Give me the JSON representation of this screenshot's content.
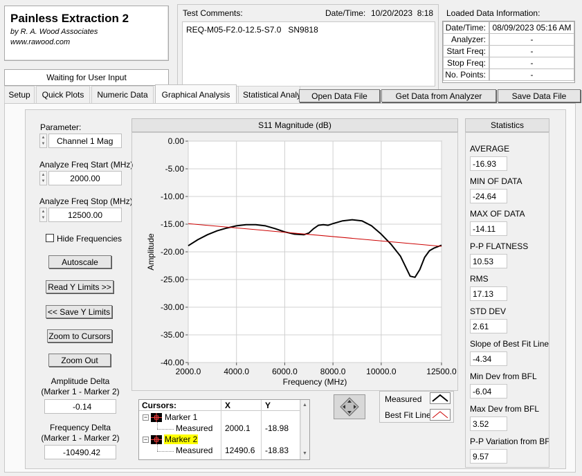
{
  "app": {
    "title": "Painless Extraction 2",
    "by": "by R. A. Wood Associates",
    "url": "www.rawood.com",
    "status": "Waiting for User Input"
  },
  "comments": {
    "label": "Test Comments:",
    "datetime_label": "Date/Time:",
    "datetime_value": "10/20/2023  8:18",
    "text": "REQ-M05-F2.0-12.5-S7.0   SN9818"
  },
  "loaded": {
    "title": "Loaded Data Information:",
    "rows": [
      {
        "label": "Date/Time:",
        "value": "08/09/2023 05:16 AM"
      },
      {
        "label": "Analyzer:",
        "value": "-"
      },
      {
        "label": "Start Freq:",
        "value": "-"
      },
      {
        "label": "Stop Freq:",
        "value": "-"
      },
      {
        "label": "No. Points:",
        "value": "-"
      }
    ]
  },
  "tabs": [
    "Setup",
    "Quick Plots",
    "Numeric Data",
    "Graphical Analysis",
    "Statistical Analy"
  ],
  "toolbar": {
    "open": "Open Data File",
    "get": "Get Data from Analyzer",
    "save": "Save Data File"
  },
  "left": {
    "parameter_label": "Parameter:",
    "parameter_value": "Channel 1 Mag",
    "start_label": "Analyze Freq Start (MHz)",
    "start_value": "2000.00",
    "stop_label": "Analyze Freq Stop (MHz)",
    "stop_value": "12500.00",
    "hide_freq": "Hide Frequencies",
    "autoscale": "Autoscale",
    "read_y": "Read Y Limits >>",
    "save_y": "<< Save Y Limits",
    "zoom_cursors": "Zoom to Cursors",
    "zoom_out": "Zoom Out",
    "amp_delta_label1": "Amplitude Delta",
    "amp_delta_label2": "(Marker 1 - Marker 2)",
    "amp_delta_value": "-0.14",
    "freq_delta_label1": "Frequency Delta",
    "freq_delta_label2": "(Marker 1 - Marker 2)",
    "freq_delta_value": "-10490.42"
  },
  "legend": {
    "measured": "Measured",
    "best_fit": "Best Fit Line"
  },
  "cursors": {
    "headers": [
      "Cursors:",
      "X",
      "Y"
    ],
    "marker1": "Marker 1",
    "marker2": "Marker 2",
    "m1_label": "Measured",
    "m1_x": "2000.1",
    "m1_y": "-18.98",
    "m2_label": "Measured",
    "m2_x": "12490.6",
    "m2_y": "-18.83"
  },
  "statistics": {
    "title": "Statistics",
    "items": [
      {
        "label": "AVERAGE",
        "value": "-16.93"
      },
      {
        "label": "MIN OF DATA",
        "value": "-24.64"
      },
      {
        "label": "MAX OF DATA",
        "value": "-14.11"
      },
      {
        "label": "P-P FLATNESS",
        "value": "10.53"
      },
      {
        "label": "RMS",
        "value": "17.13"
      },
      {
        "label": "STD DEV",
        "value": "2.61"
      },
      {
        "label": "Slope of Best Fit Line",
        "value": "-4.34"
      },
      {
        "label": "Min Dev from BFL",
        "value": "-6.04"
      },
      {
        "label": "Max Dev from BFL",
        "value": "3.52"
      },
      {
        "label": "P-P Variation from BF",
        "value": "9.57"
      }
    ]
  },
  "colors": {
    "measured": "#000000",
    "best_fit": "#cc0000",
    "highlight": "#ffff00",
    "plot_bg": "#ffffff",
    "grid": "#d0d0d0"
  },
  "chart_data": {
    "type": "line",
    "title": "S11 Magnitude (dB)",
    "xlabel": "Frequency (MHz)",
    "ylabel": "Amplitude",
    "xlim": [
      2000,
      12500
    ],
    "ylim": [
      -40,
      0
    ],
    "x_ticks": [
      "2000.0",
      "4000.0",
      "6000.0",
      "8000.0",
      "10000.0",
      "12500.0"
    ],
    "y_ticks": [
      "0.00",
      "-5.00",
      "-10.00",
      "-15.00",
      "-20.00",
      "-25.00",
      "-30.00",
      "-35.00",
      "-40.00"
    ],
    "series": [
      {
        "name": "Measured",
        "x": [
          2000,
          2400,
          2800,
          3200,
          3600,
          4000,
          4400,
          4800,
          5200,
          5600,
          6000,
          6400,
          6800,
          7000,
          7200,
          7400,
          7600,
          7800,
          8000,
          8400,
          8800,
          9200,
          9600,
          10000,
          10400,
          10800,
          11000,
          11200,
          11400,
          11600,
          11800,
          12000,
          12200,
          12500
        ],
        "y": [
          -18.9,
          -17.8,
          -16.9,
          -16.2,
          -15.7,
          -15.3,
          -15.1,
          -15.1,
          -15.3,
          -15.8,
          -16.4,
          -16.8,
          -16.9,
          -16.6,
          -15.8,
          -15.2,
          -15.1,
          -15.2,
          -14.9,
          -14.4,
          -14.2,
          -14.4,
          -15.3,
          -16.8,
          -18.6,
          -20.8,
          -22.6,
          -24.4,
          -24.6,
          -23.2,
          -21.0,
          -19.8,
          -19.3,
          -18.8
        ]
      },
      {
        "name": "Best Fit Line",
        "x": [
          2000,
          12500
        ],
        "y": [
          -14.9,
          -19.0
        ]
      }
    ]
  }
}
